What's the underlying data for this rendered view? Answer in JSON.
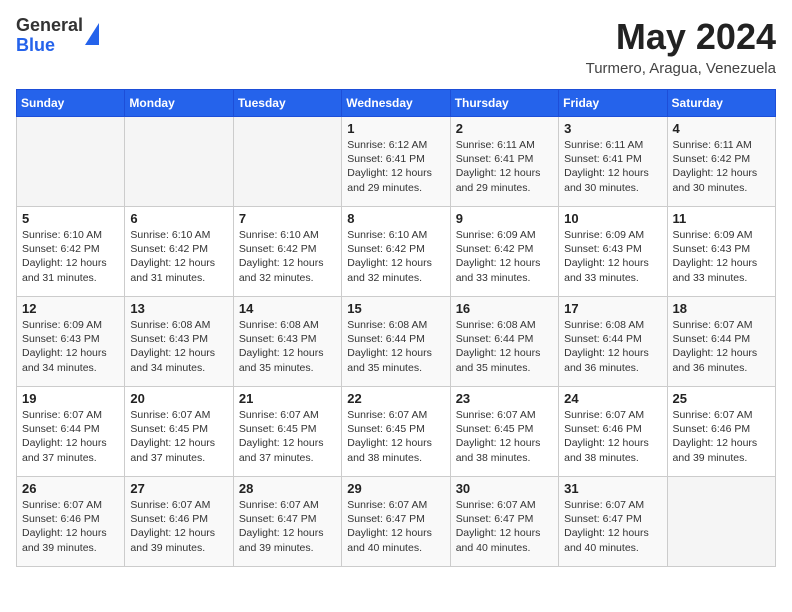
{
  "header": {
    "logo_line1": "General",
    "logo_line2": "Blue",
    "title": "May 2024",
    "location": "Turmero, Aragua, Venezuela"
  },
  "weekdays": [
    "Sunday",
    "Monday",
    "Tuesday",
    "Wednesday",
    "Thursday",
    "Friday",
    "Saturday"
  ],
  "weeks": [
    [
      {
        "day": "",
        "info": ""
      },
      {
        "day": "",
        "info": ""
      },
      {
        "day": "",
        "info": ""
      },
      {
        "day": "1",
        "info": "Sunrise: 6:12 AM\nSunset: 6:41 PM\nDaylight: 12 hours\nand 29 minutes."
      },
      {
        "day": "2",
        "info": "Sunrise: 6:11 AM\nSunset: 6:41 PM\nDaylight: 12 hours\nand 29 minutes."
      },
      {
        "day": "3",
        "info": "Sunrise: 6:11 AM\nSunset: 6:41 PM\nDaylight: 12 hours\nand 30 minutes."
      },
      {
        "day": "4",
        "info": "Sunrise: 6:11 AM\nSunset: 6:42 PM\nDaylight: 12 hours\nand 30 minutes."
      }
    ],
    [
      {
        "day": "5",
        "info": "Sunrise: 6:10 AM\nSunset: 6:42 PM\nDaylight: 12 hours\nand 31 minutes."
      },
      {
        "day": "6",
        "info": "Sunrise: 6:10 AM\nSunset: 6:42 PM\nDaylight: 12 hours\nand 31 minutes."
      },
      {
        "day": "7",
        "info": "Sunrise: 6:10 AM\nSunset: 6:42 PM\nDaylight: 12 hours\nand 32 minutes."
      },
      {
        "day": "8",
        "info": "Sunrise: 6:10 AM\nSunset: 6:42 PM\nDaylight: 12 hours\nand 32 minutes."
      },
      {
        "day": "9",
        "info": "Sunrise: 6:09 AM\nSunset: 6:42 PM\nDaylight: 12 hours\nand 33 minutes."
      },
      {
        "day": "10",
        "info": "Sunrise: 6:09 AM\nSunset: 6:43 PM\nDaylight: 12 hours\nand 33 minutes."
      },
      {
        "day": "11",
        "info": "Sunrise: 6:09 AM\nSunset: 6:43 PM\nDaylight: 12 hours\nand 33 minutes."
      }
    ],
    [
      {
        "day": "12",
        "info": "Sunrise: 6:09 AM\nSunset: 6:43 PM\nDaylight: 12 hours\nand 34 minutes."
      },
      {
        "day": "13",
        "info": "Sunrise: 6:08 AM\nSunset: 6:43 PM\nDaylight: 12 hours\nand 34 minutes."
      },
      {
        "day": "14",
        "info": "Sunrise: 6:08 AM\nSunset: 6:43 PM\nDaylight: 12 hours\nand 35 minutes."
      },
      {
        "day": "15",
        "info": "Sunrise: 6:08 AM\nSunset: 6:44 PM\nDaylight: 12 hours\nand 35 minutes."
      },
      {
        "day": "16",
        "info": "Sunrise: 6:08 AM\nSunset: 6:44 PM\nDaylight: 12 hours\nand 35 minutes."
      },
      {
        "day": "17",
        "info": "Sunrise: 6:08 AM\nSunset: 6:44 PM\nDaylight: 12 hours\nand 36 minutes."
      },
      {
        "day": "18",
        "info": "Sunrise: 6:07 AM\nSunset: 6:44 PM\nDaylight: 12 hours\nand 36 minutes."
      }
    ],
    [
      {
        "day": "19",
        "info": "Sunrise: 6:07 AM\nSunset: 6:44 PM\nDaylight: 12 hours\nand 37 minutes."
      },
      {
        "day": "20",
        "info": "Sunrise: 6:07 AM\nSunset: 6:45 PM\nDaylight: 12 hours\nand 37 minutes."
      },
      {
        "day": "21",
        "info": "Sunrise: 6:07 AM\nSunset: 6:45 PM\nDaylight: 12 hours\nand 37 minutes."
      },
      {
        "day": "22",
        "info": "Sunrise: 6:07 AM\nSunset: 6:45 PM\nDaylight: 12 hours\nand 38 minutes."
      },
      {
        "day": "23",
        "info": "Sunrise: 6:07 AM\nSunset: 6:45 PM\nDaylight: 12 hours\nand 38 minutes."
      },
      {
        "day": "24",
        "info": "Sunrise: 6:07 AM\nSunset: 6:46 PM\nDaylight: 12 hours\nand 38 minutes."
      },
      {
        "day": "25",
        "info": "Sunrise: 6:07 AM\nSunset: 6:46 PM\nDaylight: 12 hours\nand 39 minutes."
      }
    ],
    [
      {
        "day": "26",
        "info": "Sunrise: 6:07 AM\nSunset: 6:46 PM\nDaylight: 12 hours\nand 39 minutes."
      },
      {
        "day": "27",
        "info": "Sunrise: 6:07 AM\nSunset: 6:46 PM\nDaylight: 12 hours\nand 39 minutes."
      },
      {
        "day": "28",
        "info": "Sunrise: 6:07 AM\nSunset: 6:47 PM\nDaylight: 12 hours\nand 39 minutes."
      },
      {
        "day": "29",
        "info": "Sunrise: 6:07 AM\nSunset: 6:47 PM\nDaylight: 12 hours\nand 40 minutes."
      },
      {
        "day": "30",
        "info": "Sunrise: 6:07 AM\nSunset: 6:47 PM\nDaylight: 12 hours\nand 40 minutes."
      },
      {
        "day": "31",
        "info": "Sunrise: 6:07 AM\nSunset: 6:47 PM\nDaylight: 12 hours\nand 40 minutes."
      },
      {
        "day": "",
        "info": ""
      }
    ]
  ]
}
